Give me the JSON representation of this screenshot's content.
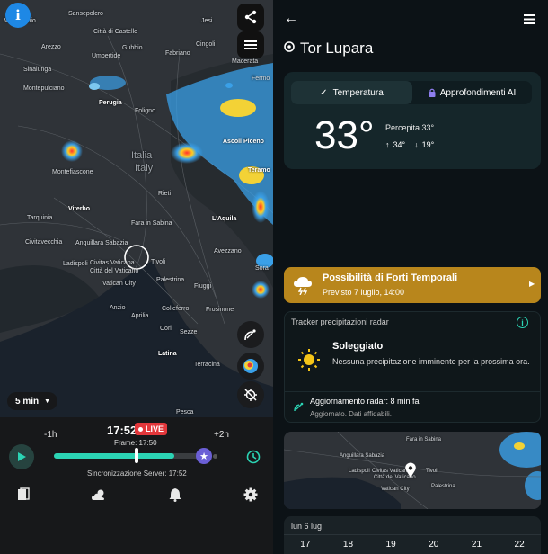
{
  "map": {
    "cities": [
      {
        "label": "Montecchio"
      },
      {
        "label": "Sansepolcro"
      },
      {
        "label": "Jesi"
      },
      {
        "label": "Città di Castello"
      },
      {
        "label": "Arezzo"
      },
      {
        "label": "Gubbio"
      },
      {
        "label": "Fabriano"
      },
      {
        "label": "Cingoli"
      },
      {
        "label": "Umbertide"
      },
      {
        "label": "Macerata"
      },
      {
        "label": "Sinalunga"
      },
      {
        "label": "Fermo"
      },
      {
        "label": "Montepulciano"
      },
      {
        "label": "Perugia"
      },
      {
        "label": "Foligno"
      },
      {
        "label": "Ascoli Piceno"
      },
      {
        "label": "Montefiascone"
      },
      {
        "label": "Italia"
      },
      {
        "label": "Italy"
      },
      {
        "label": "Rieti"
      },
      {
        "label": "Teramo"
      },
      {
        "label": "Viterbo"
      },
      {
        "label": "Tarquinia"
      },
      {
        "label": "Fara in Sabina"
      },
      {
        "label": "L'Aquila"
      },
      {
        "label": "Civitavecchia"
      },
      {
        "label": "Anguillara Sabazia"
      },
      {
        "label": "Avezzano"
      },
      {
        "label": "Ladispoli"
      },
      {
        "label": "Tivoli"
      },
      {
        "label": "Sora"
      },
      {
        "label": "Città del Vaticano"
      },
      {
        "label": "Civitas Vaticana"
      },
      {
        "label": "Vatican City"
      },
      {
        "label": "Palestrina"
      },
      {
        "label": "Fiuggi"
      },
      {
        "label": "Anzio"
      },
      {
        "label": "Colleferro"
      },
      {
        "label": "Frosinone"
      },
      {
        "label": "Aprilia"
      },
      {
        "label": "Cori"
      },
      {
        "label": "Sezze"
      },
      {
        "label": "Latina"
      },
      {
        "label": "Terracina"
      },
      {
        "label": "Pesca"
      }
    ],
    "zoom_label": "5 min"
  },
  "controls": {
    "minus": "-1h",
    "plus": "+2h",
    "time": "17:52",
    "live": "LIVE",
    "frame": "Frame: 17:50",
    "sync": "Sincronizzazione Server: 17:52",
    "progress": 0.76
  },
  "right": {
    "location": "Tor Lupara",
    "tabs": {
      "temp": "Temperatura",
      "ai": "Approfondimenti AI"
    },
    "temp": "33°",
    "perceived": "Percepita 33°",
    "max": "34°",
    "min": "19°",
    "alert": {
      "title": "Possibilità di Forti Temporali",
      "sub": "Previsto 7 luglio, 14:00"
    },
    "tracker": {
      "title": "Tracker precipitazioni radar",
      "cond": "Soleggiato",
      "desc": "Nessuna precipitazione imminente per la prossima ora.",
      "update": "Aggiornamento radar: 8 min fa",
      "reliable": "Aggiornato. Dati affidabili."
    },
    "minimap": {
      "cities": [
        {
          "label": "Fara in Sabina"
        },
        {
          "label": "Anguillara Sabazia"
        },
        {
          "label": "Ladispoli"
        },
        {
          "label": "Civitas Vaticana"
        },
        {
          "label": "Città del Vaticano"
        },
        {
          "label": "Vatican City"
        },
        {
          "label": "Tivoli"
        },
        {
          "label": "Palestrina"
        }
      ]
    },
    "hourly": {
      "date": "lun 6 lug",
      "hours": [
        "17",
        "18",
        "19",
        "20",
        "21",
        "22"
      ]
    }
  },
  "colors": {
    "accent": "#2bd4b4",
    "alert": "#b8861c",
    "live": "#e2373b",
    "star": "#6b5fd6"
  }
}
